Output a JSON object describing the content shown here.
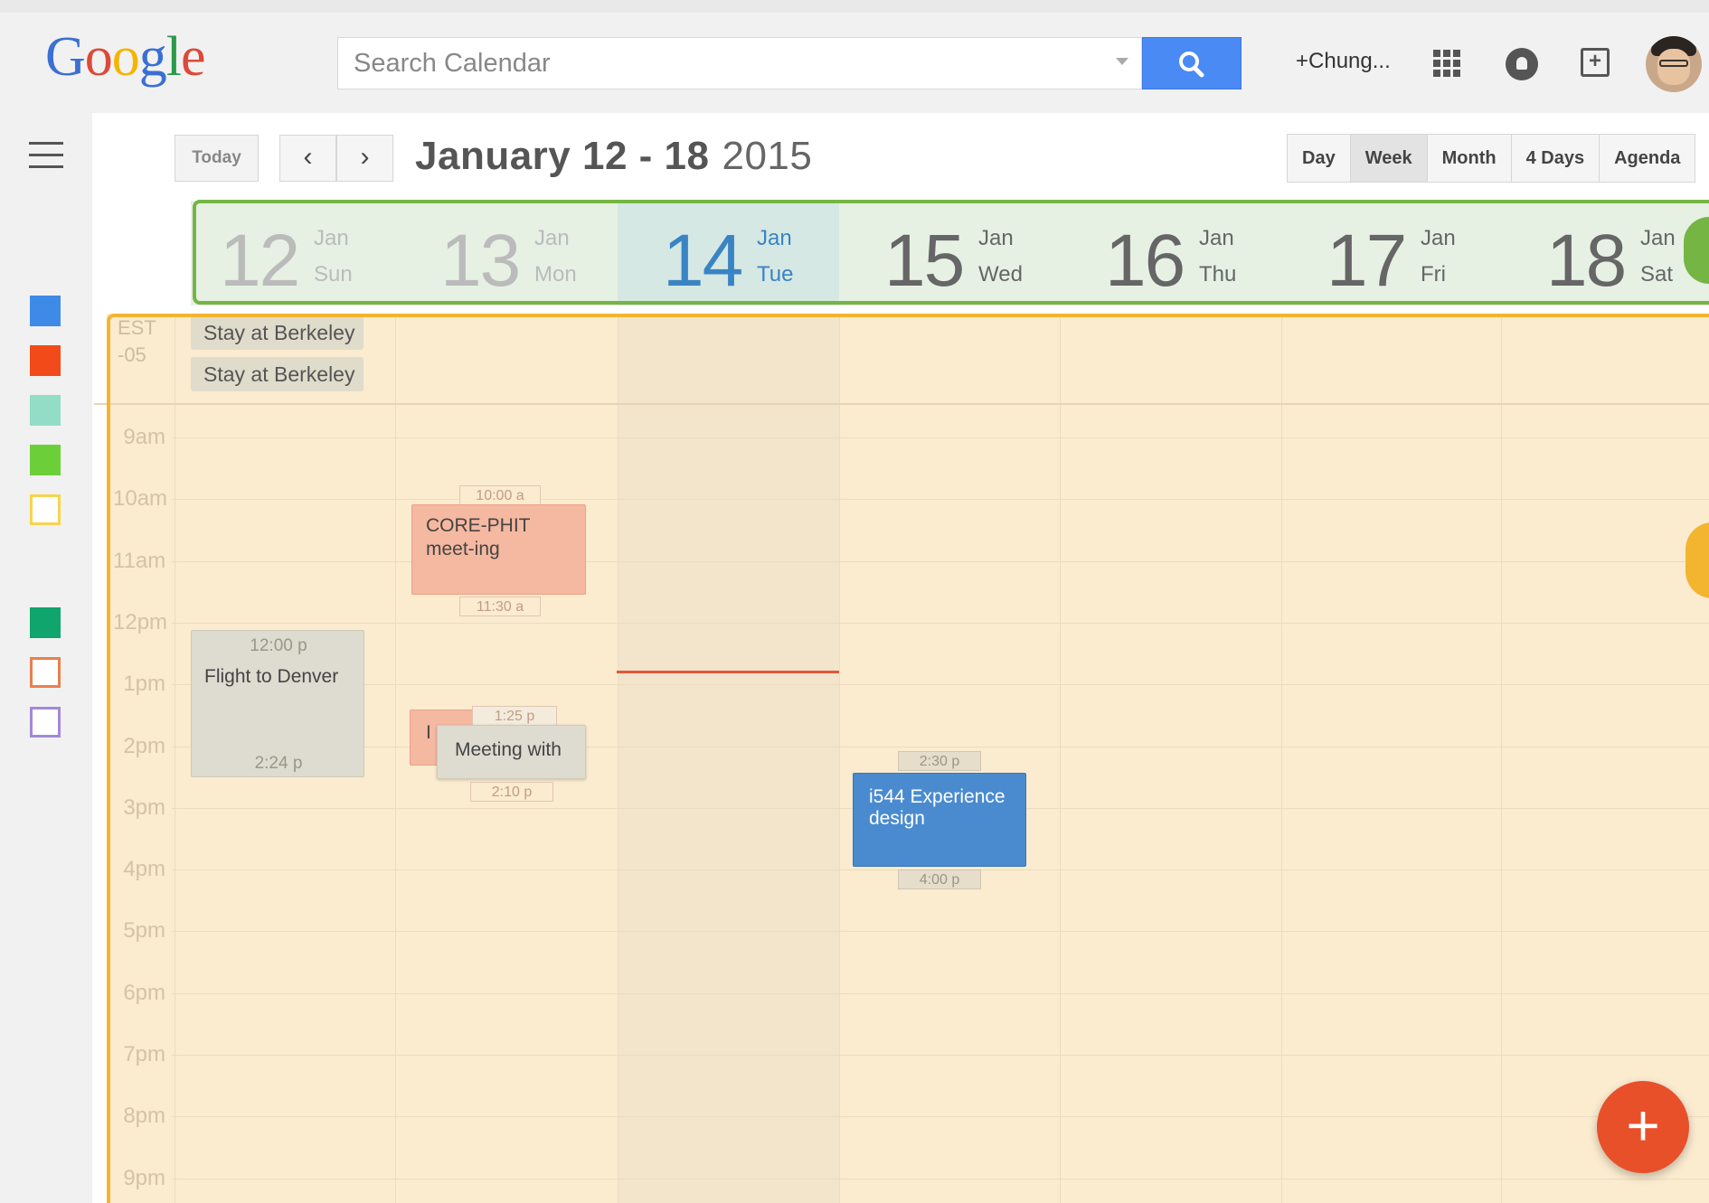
{
  "header": {
    "logo_letters": [
      {
        "ch": "G",
        "color": "#3b6fd4"
      },
      {
        "ch": "o",
        "color": "#dc4a38"
      },
      {
        "ch": "o",
        "color": "#f4b400"
      },
      {
        "ch": "g",
        "color": "#3b6fd4"
      },
      {
        "ch": "l",
        "color": "#2b9a48"
      },
      {
        "ch": "e",
        "color": "#dc4a38"
      }
    ],
    "search_placeholder": "Search Calendar",
    "user_link": "+Chung...",
    "icons": [
      "search-icon",
      "apps-grid-icon",
      "notifications-icon",
      "share-icon"
    ]
  },
  "toolbar": {
    "today": "Today",
    "prev": "‹",
    "next": "›",
    "range": "January 12 - 18",
    "year": "2015",
    "views": [
      "Day",
      "Week",
      "Month",
      "4 Days",
      "Agenda"
    ],
    "active_view": "Week"
  },
  "days": [
    {
      "num": "12",
      "month": "Jan",
      "weekday": "Sun",
      "state": "past"
    },
    {
      "num": "13",
      "month": "Jan",
      "weekday": "Mon",
      "state": "past"
    },
    {
      "num": "14",
      "month": "Jan",
      "weekday": "Tue",
      "state": "today"
    },
    {
      "num": "15",
      "month": "Jan",
      "weekday": "Wed",
      "state": "future"
    },
    {
      "num": "16",
      "month": "Jan",
      "weekday": "Thu",
      "state": "future"
    },
    {
      "num": "17",
      "month": "Jan",
      "weekday": "Fri",
      "state": "future"
    },
    {
      "num": "18",
      "month": "Jan",
      "weekday": "Sat",
      "state": "future"
    }
  ],
  "timezone": [
    "EST",
    "-05"
  ],
  "hours": [
    "9am",
    "10am",
    "11am",
    "12pm",
    "1pm",
    "2pm",
    "3pm",
    "4pm",
    "5pm",
    "6pm",
    "7pm",
    "8pm",
    "9pm"
  ],
  "all_day_events": [
    {
      "title": "Stay at Berkeley"
    },
    {
      "title": "Stay at Berkeley"
    }
  ],
  "events": {
    "core_phit": {
      "title": "CORE-PHIT meet-ing",
      "start": "10:00 a",
      "end": "11:30 a",
      "color": "#f5b8a0"
    },
    "flight": {
      "title": "Flight to Denver",
      "start": "12:00 p",
      "end": "2:24 p",
      "color": "#dedbd0"
    },
    "meeting_with": {
      "title": "Meeting with",
      "start": "1:25 p",
      "end": "2:10 p",
      "color": "#dedbd0"
    },
    "hidden_overlap": {
      "title": "I",
      "color": "#f5b8a0"
    },
    "experience_design": {
      "title": "i544 Experience design",
      "start": "2:30 p",
      "end": "4:00 p",
      "color": "#4a8bd0"
    }
  },
  "calendar_swatches": [
    {
      "color": "#3e8be7",
      "filled": true
    },
    {
      "color": "#f24b1a",
      "filled": true
    },
    {
      "color": "#93ddc7",
      "filled": true
    },
    {
      "color": "#6ccf3a",
      "filled": true
    },
    {
      "color": "#f8d44c",
      "filled": false
    },
    {
      "color": "#10a56d",
      "filled": true
    },
    {
      "color": "#e8804e",
      "filled": false
    },
    {
      "color": "#a388d8",
      "filled": false
    }
  ],
  "fab_label": "+",
  "annotation_colors": {
    "header_highlight": "#74b543",
    "grid_highlight": "#f3b430"
  }
}
